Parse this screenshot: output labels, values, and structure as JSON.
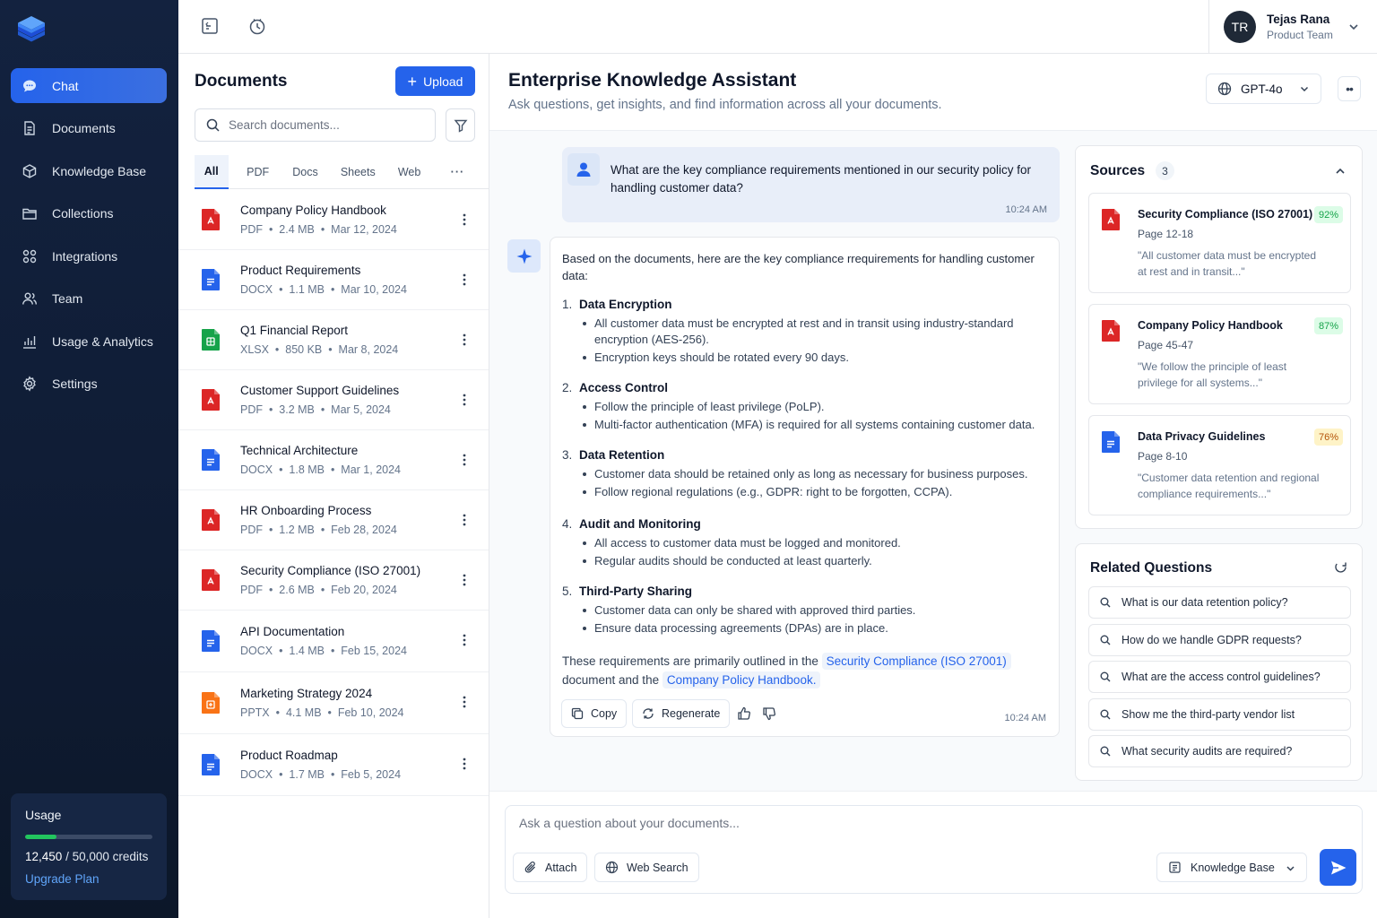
{
  "sidebar": {
    "logo_icon": "stack-layers-icon",
    "items": [
      {
        "label": "Chat",
        "icon": "chat-bubble-icon",
        "active": true
      },
      {
        "label": "Documents",
        "icon": "document-icon"
      },
      {
        "label": "Knowledge Base",
        "icon": "cube-icon"
      },
      {
        "label": "Collections",
        "icon": "folder-icon"
      },
      {
        "label": "Integrations",
        "icon": "integrations-icon"
      },
      {
        "label": "Team",
        "icon": "team-icon"
      },
      {
        "label": "Usage & Analytics",
        "icon": "bar-chart-icon"
      },
      {
        "label": "Settings",
        "icon": "gear-icon"
      }
    ],
    "usage": {
      "title": "Usage",
      "used": "12,450",
      "total": "/ 50,000 credits",
      "fraction": 0.249,
      "upgrade_label": "Upgrade Plan",
      "bar_color": "#22c55e"
    }
  },
  "topbar": {
    "icons": [
      "sidebar-toggle-icon",
      "history-icon"
    ],
    "user": {
      "initials": "TR",
      "name": "Tejas Rana",
      "role": "Product Team"
    }
  },
  "documents": {
    "title": "Documents",
    "upload_label": "Upload",
    "search_placeholder": "Search documents...",
    "tabs": [
      "All",
      "PDF",
      "Docs",
      "Sheets",
      "Web"
    ],
    "active_tab": "All",
    "items": [
      {
        "name": "Company Policy Handbook",
        "type": "PDF",
        "size": "2.4 MB",
        "date": "Mar 12, 2024"
      },
      {
        "name": "Product Requirements",
        "type": "DOCX",
        "size": "1.1 MB",
        "date": "Mar 10, 2024"
      },
      {
        "name": "Q1 Financial Report",
        "type": "XLSX",
        "size": "850 KB",
        "date": "Mar 8, 2024"
      },
      {
        "name": "Customer Support Guidelines",
        "type": "PDF",
        "size": "3.2 MB",
        "date": "Mar 5, 2024"
      },
      {
        "name": "Technical Architecture",
        "type": "DOCX",
        "size": "1.8 MB",
        "date": "Mar 1, 2024"
      },
      {
        "name": "HR Onboarding Process",
        "type": "PDF",
        "size": "1.2 MB",
        "date": "Feb 28, 2024"
      },
      {
        "name": "Security Compliance (ISO 27001)",
        "type": "PDF",
        "size": "2.6 MB",
        "date": "Feb 20, 2024"
      },
      {
        "name": "API Documentation",
        "type": "DOCX",
        "size": "1.4 MB",
        "date": "Feb 15, 2024"
      },
      {
        "name": "Marketing Strategy 2024",
        "type": "PPTX",
        "size": "4.1 MB",
        "date": "Feb 10, 2024"
      },
      {
        "name": "Product Roadmap",
        "type": "DOCX",
        "size": "1.7 MB",
        "date": "Feb 5, 2024"
      }
    ]
  },
  "main": {
    "title": "Enterprise Knowledge Assistant",
    "subtitle": "Ask questions, get insights, and find information across all your documents.",
    "model": "GPT-4o",
    "user_message": {
      "text": "What are the key compliance requirements mentioned in our security policy for handling customer data?",
      "time": "10:24 AM"
    },
    "assistant": {
      "intro": "Based on the documents, here are the key compliance rrequirements for handling customer data:",
      "sections": [
        {
          "num": "1.",
          "title": "Data Encryption",
          "bullets": [
            "All customer data must be encrypted at rest and in transit using industry-standard encryption (AES-256).",
            "Encryption keys should be rotated every 90 days."
          ]
        },
        {
          "num": "2.",
          "title": "Access Control",
          "bullets": [
            "Follow the principle of least privilege (PoLP).",
            "Multi-factor authentication (MFA) is required for all systems containing customer data."
          ]
        },
        {
          "num": "3.",
          "title": "Data Retention",
          "bullets": [
            "Customer data should be retained only as long as necessary for business purposes.",
            "Follow regional regulations (e.g., GDPR: right to be forgotten, CCPA)."
          ]
        },
        {
          "num": "4.",
          "title": "Audit and Monitoring",
          "bullets": [
            "All access to customer data must be logged and monitored.",
            "Regular audits should be conducted at least quarterly."
          ]
        },
        {
          "num": "5.",
          "title": "Third-Party Sharing",
          "bullets": [
            "Customer data can only be shared with approved third parties.",
            "Ensure data processing agreements (DPAs) are in place."
          ]
        }
      ],
      "closing_pre": "These requirements are primarily outlined in the",
      "cite1": "Security Compliance (ISO 27001)",
      "closing_mid": "document and the",
      "cite2": "Company Policy Handbook.",
      "copy_label": "Copy",
      "regen_label": "Regenerate",
      "time": "10:24 AM"
    },
    "input": {
      "placeholder": "Ask a question about your documents...",
      "attach_label": "Attach",
      "web_label": "Web Search",
      "kb_label": "Knowledge Base"
    }
  },
  "sources": {
    "title": "Sources",
    "count": "3",
    "items": [
      {
        "name": "Security Compliance (ISO 27001)",
        "page": "Page 12-18",
        "quote": "\"All customer data must be encrypted at rest and in transit...\"",
        "score": "92%",
        "kind": "pdf",
        "badge_bg": "#dcfce7",
        "badge_fg": "#16a34a"
      },
      {
        "name": "Company Policy Handbook",
        "page": "Page 45-47",
        "quote": "\"We follow the principle of least privilege for all systems...\"",
        "score": "87%",
        "kind": "pdf",
        "badge_bg": "#dcfce7",
        "badge_fg": "#16a34a"
      },
      {
        "name": "Data Privacy Guidelines",
        "page": "Page 8-10",
        "quote": "\"Customer data retention and regional compliance requirements...\"",
        "score": "76%",
        "kind": "doc",
        "badge_bg": "#fef3c7",
        "badge_fg": "#b45309"
      }
    ]
  },
  "related": {
    "title": "Related Questions",
    "items": [
      "What is our data retention policy?",
      "How do we handle GDPR requests?",
      "What are the access control guidelines?",
      "Show me the third-party vendor list",
      "What security audits are required?"
    ]
  },
  "colors": {
    "accent": "#2563eb",
    "pdf": "#dc2626",
    "docx": "#2563eb",
    "xlsx": "#16a34a",
    "pptx": "#f97316"
  }
}
